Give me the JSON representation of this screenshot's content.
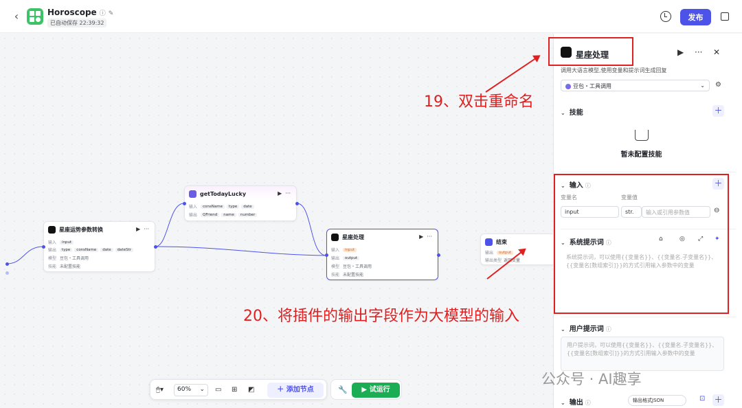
{
  "app": {
    "title": "Horoscope",
    "autosave": "已自动保存 22:39:32",
    "publish_label": "发布"
  },
  "nodes": {
    "n1": {
      "title": "星座运势参数转换",
      "in_label": "输入",
      "in_tags": [
        "input"
      ],
      "out_label": "输出",
      "out_tags": [
        "type",
        "consName",
        "date",
        "dateStr"
      ],
      "model_label": "模型",
      "model_value": "豆包・工具调用",
      "skill_label": "技能",
      "skill_value": "未配置技能"
    },
    "n2": {
      "title": "getTodayLucky",
      "in_label": "输入",
      "in_tags": [
        "consName",
        "type",
        "date"
      ],
      "out_label": "输出",
      "out_tags": [
        "QFriend",
        "name",
        "number"
      ]
    },
    "n3": {
      "title": "星座处理",
      "in_label": "输入",
      "in_tag": "input",
      "out_label": "输出",
      "out_tag": "output",
      "model_label": "模型",
      "model_value": "豆包・工具调用",
      "skill_label": "技能",
      "skill_value": "未配置技能"
    },
    "n4": {
      "title": "结束",
      "out_label": "输出",
      "out_tag": "output",
      "type_label": "输出类型",
      "type_value": "返回变量"
    }
  },
  "toolbar": {
    "zoom": "60%",
    "add_node": "添加节点",
    "run": "试运行"
  },
  "panel": {
    "title": "星座处理",
    "description": "调用大语言模型,使用变量和提示词生成回复",
    "model": "豆包・工具调用",
    "skills": {
      "label": "技能",
      "empty": "暂未配置技能"
    },
    "input": {
      "label": "输入",
      "col_name": "变量名",
      "col_value": "变量值",
      "name_value": "input",
      "type_value": "str.",
      "value_placeholder": "输入或引用参数值"
    },
    "system_prompt": {
      "label": "系统提示词",
      "placeholder": "系统提示词，可以使用{{变量名}}、{{变量名.子变量名}}、{{变量名[数组索引]}}的方式引用输入参数中的变量"
    },
    "user_prompt": {
      "label": "用户提示词",
      "placeholder": "用户提示词，可以使用{{变量名}}、{{变量名.子变量名}}、{{变量名[数组索引]}}的方式引用输入参数中的变量"
    },
    "output": {
      "label": "输出",
      "format": "输出格式JSON"
    }
  },
  "annotations": {
    "a19": "19、双击重命名",
    "a20": "20、将插件的输出字段作为大模型的输入"
  },
  "watermark": "公众号 · AI趣享",
  "colors": {
    "accent": "#4d53e8",
    "run": "#1aad54",
    "annotation": "#e02020"
  }
}
